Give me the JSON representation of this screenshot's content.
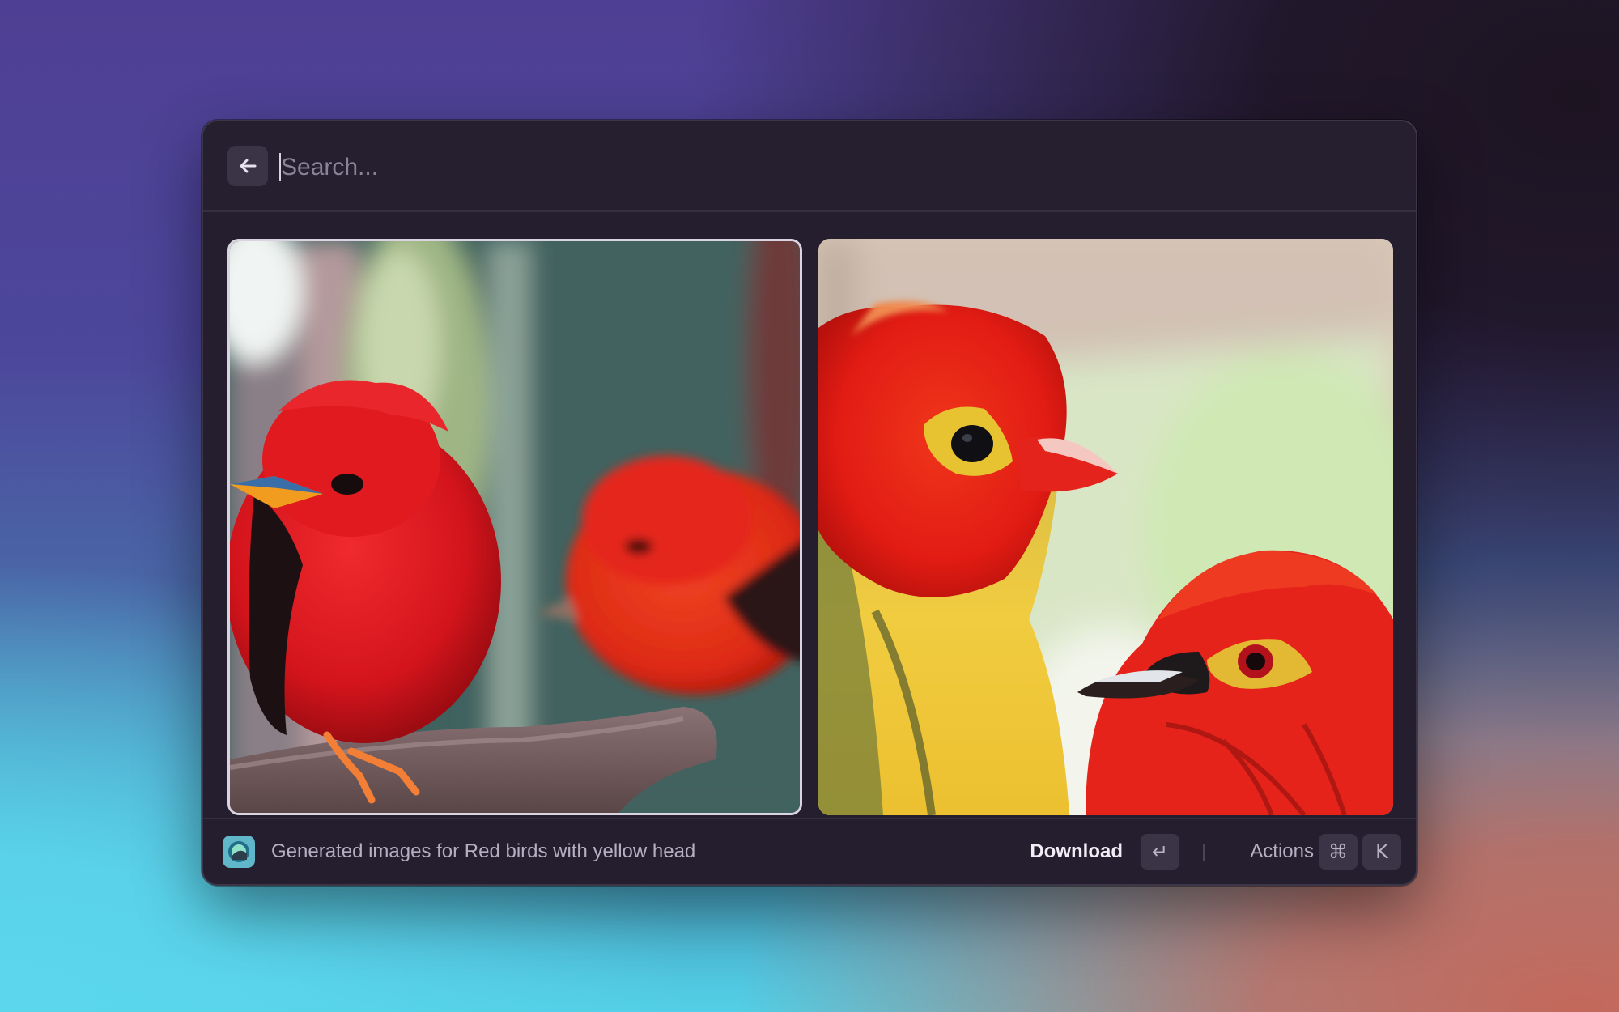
{
  "search": {
    "placeholder": "Search...",
    "value": ""
  },
  "header": {
    "back_icon": "arrow-left-icon"
  },
  "images": [
    {
      "name": "generated-image-1",
      "selected": true
    },
    {
      "name": "generated-image-2",
      "selected": false
    }
  ],
  "footer": {
    "app_icon": "image-generator-icon",
    "title": "Generated images for Red birds with yellow head",
    "primary_action": "Download",
    "primary_shortcut": "↵",
    "actions_label": "Actions",
    "actions_shortcut_mod": "⌘",
    "actions_shortcut_key": "K"
  },
  "colors": {
    "window_bg": "#241e2f",
    "key_bg": "#3a3446",
    "selected_border": "#d9d4df"
  }
}
